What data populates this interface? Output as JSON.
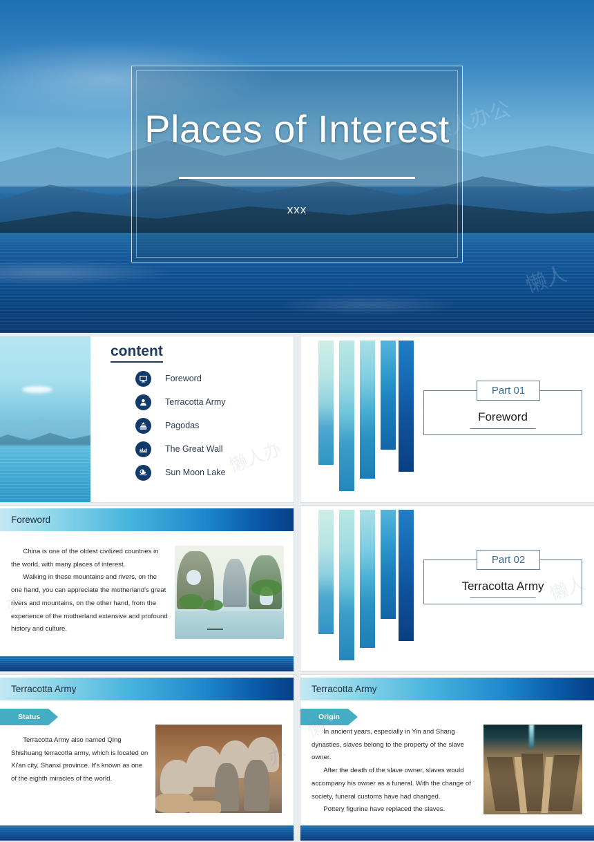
{
  "title_slide": {
    "title": "Places of Interest",
    "subtitle": "xxx"
  },
  "content_slide": {
    "heading": "content",
    "items": [
      {
        "label": "Foreword",
        "icon": "monitor-icon"
      },
      {
        "label": "Terracotta Army",
        "icon": "person-icon"
      },
      {
        "label": "Pagodas",
        "icon": "pagoda-icon"
      },
      {
        "label": "The Great Wall",
        "icon": "great-wall-icon"
      },
      {
        "label": "Sun Moon Lake",
        "icon": "sun-moon-lake-icon"
      }
    ]
  },
  "section_part01": {
    "badge": "Part 01",
    "name": "Foreword"
  },
  "section_part02": {
    "badge": "Part 02",
    "name": "Terracotta Army"
  },
  "foreword_slide": {
    "header": "Foreword",
    "paragraph1": "China is one of the oldest civilized countries in the world, with many places of interest.",
    "paragraph2": "Walking in these mountains and rivers, on the one hand, you can appreciate the motherland's great rivers and mountains, on the other hand, from the experience of the motherland extensive and profound history and culture."
  },
  "terracotta_status_slide": {
    "header": "Terracotta Army",
    "tag": "Status",
    "paragraph1": "Terracotta Army also named Qing Shishuang terracotta army, which is located on Xi'an city, Shanxi province. It's known as one of the eighth miracles of the world."
  },
  "terracotta_origin_slide": {
    "header": "Terracotta Army",
    "tag": "Origin",
    "paragraph1": "In ancient years, especially in Yin and Shang dynasties, slaves belong to the property of the slave owner.",
    "paragraph2": "After the death of the slave owner, slaves would accompany his owner as a funeral. With the change of society, funeral customs have had changed.",
    "paragraph3": "Pottery figurine have replaced the slaves."
  },
  "colors": {
    "deep_navy": "#123a6b",
    "header_gradient_start": "#c3e8f3",
    "header_gradient_end": "#063f86",
    "tag_teal": "#44adc4",
    "frame_blue": "#5f7f99",
    "part_label_blue": "#3c6e91"
  }
}
